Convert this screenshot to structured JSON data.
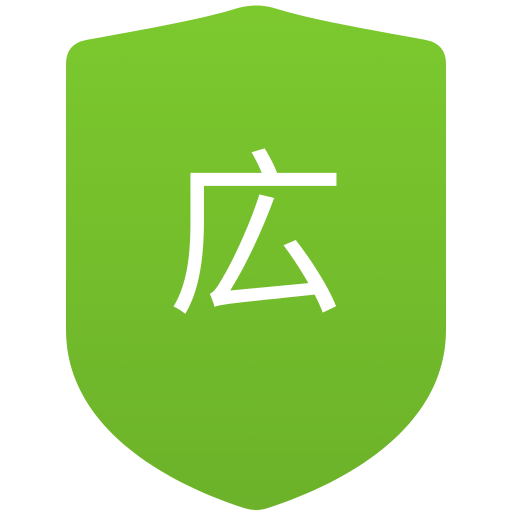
{
  "icon": {
    "name": "ad-block-shield-icon",
    "glyph": "広",
    "colors": {
      "shield_top": "#7cc92e",
      "shield_bottom": "#6cb22a",
      "glyph": "#ffffff",
      "background": "#ffffff"
    }
  }
}
